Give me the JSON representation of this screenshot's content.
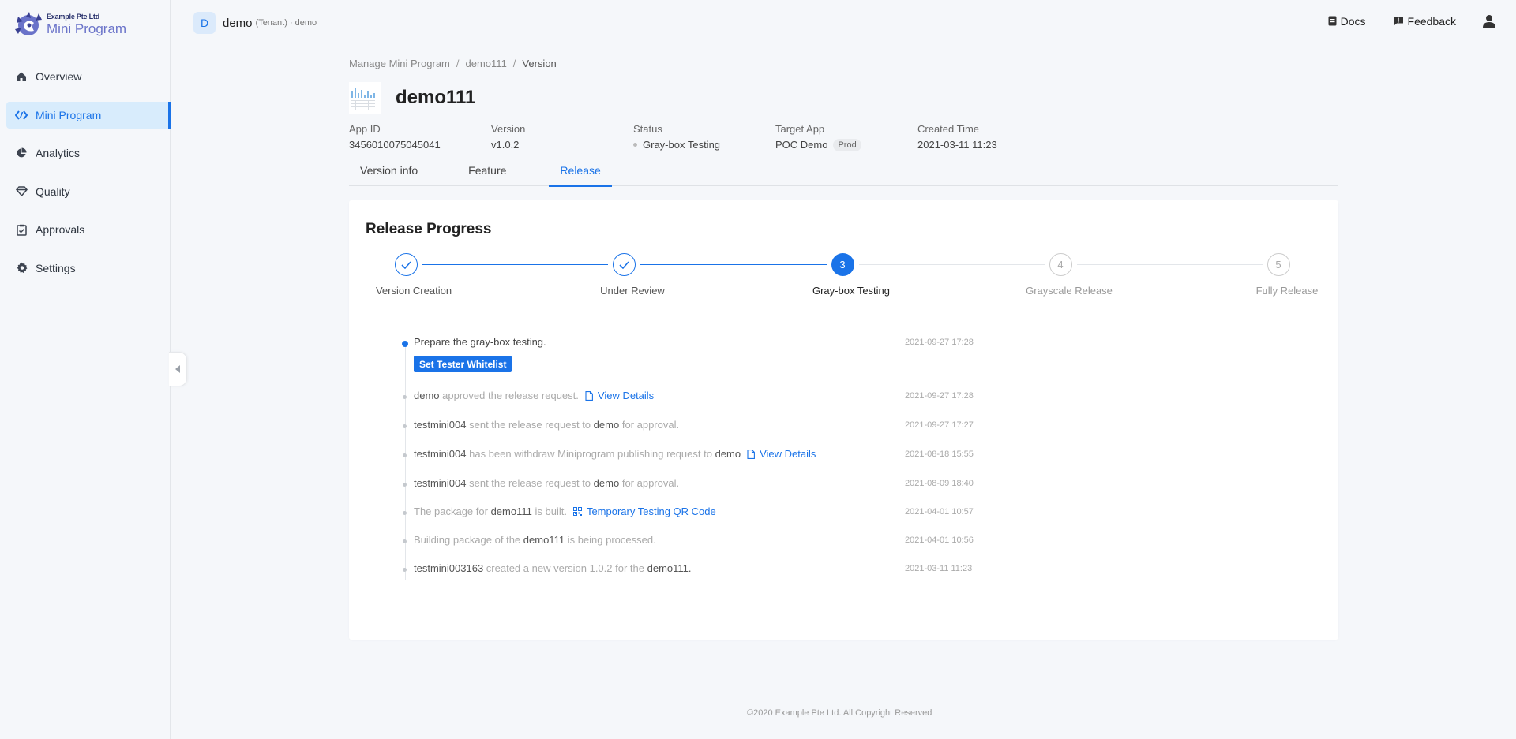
{
  "brand": {
    "company": "Example Pte Ltd",
    "product": "Mini Program"
  },
  "nav": [
    {
      "label": "Overview",
      "icon": "home-icon"
    },
    {
      "label": "Mini Program",
      "icon": "code-icon",
      "active": true
    },
    {
      "label": "Analytics",
      "icon": "pie-chart-icon"
    },
    {
      "label": "Quality",
      "icon": "diamond-icon"
    },
    {
      "label": "Approvals",
      "icon": "clipboard-icon"
    },
    {
      "label": "Settings",
      "icon": "gear-icon"
    }
  ],
  "tenant": {
    "initial": "D",
    "name": "demo",
    "meta": "(Tenant) · demo"
  },
  "top_actions": {
    "docs": "Docs",
    "feedback": "Feedback"
  },
  "breadcrumb": [
    "Manage Mini Program",
    "demo111",
    "Version"
  ],
  "app": {
    "name": "demo111"
  },
  "meta": {
    "app_id_label": "App ID",
    "app_id": "3456010075045041",
    "version_label": "Version",
    "version": "v1.0.2",
    "status_label": "Status",
    "status": "Gray-box Testing",
    "target_label": "Target App",
    "target": "POC Demo",
    "target_tag": "Prod",
    "created_label": "Created Time",
    "created": "2021-03-11 11:23"
  },
  "tabs": [
    "Version info",
    "Feature",
    "Release"
  ],
  "active_tab": "Release",
  "release": {
    "title": "Release Progress",
    "steps": [
      {
        "label": "Version Creation",
        "state": "done",
        "num": "1"
      },
      {
        "label": "Under Review",
        "state": "done",
        "num": "2"
      },
      {
        "label": "Gray-box Testing",
        "state": "current",
        "num": "3"
      },
      {
        "label": "Grayscale Release",
        "state": "todo",
        "num": "4"
      },
      {
        "label": "Fully Release",
        "state": "todo",
        "num": "5"
      }
    ],
    "events": {
      "e0": {
        "text": "Prepare the gray-box testing.",
        "button": "Set Tester Whitelist",
        "time": "2021-09-27 17:28"
      },
      "e1": {
        "actor": "demo",
        "text": "approved the release request.",
        "link": "View Details",
        "time": "2021-09-27 17:28"
      },
      "e2": {
        "actor": "testmini004",
        "text1": "sent the release request to",
        "target": "demo",
        "text2": "for approval.",
        "time": "2021-09-27 17:27"
      },
      "e3": {
        "actor": "testmini004",
        "text1": "has been withdraw Miniprogram publishing request to",
        "target": "demo",
        "link": "View Details",
        "time": "2021-08-18 15:55"
      },
      "e4": {
        "actor": "testmini004",
        "text1": "sent the release request to",
        "target": "demo",
        "text2": "for approval.",
        "time": "2021-08-09 18:40"
      },
      "e5": {
        "text1": "The package for",
        "target": "demo111",
        "text2": "is built.",
        "link": "Temporary Testing QR Code",
        "time": "2021-04-01 10:57"
      },
      "e6": {
        "text1": "Building package of the",
        "target": "demo111",
        "text2": "is being processed.",
        "time": "2021-04-01 10:56"
      },
      "e7": {
        "actor": "testmini003163",
        "text1": "created a new version 1.0.2 for the",
        "target": "demo111.",
        "time": "2021-03-11 11:23"
      }
    }
  },
  "footer": "©2020 Example Pte Ltd. All Copyright Reserved",
  "colors": {
    "accent": "#1a73e8",
    "nav_active_bg": "#d8ecfc",
    "page_bg": "#f5f7fa"
  }
}
